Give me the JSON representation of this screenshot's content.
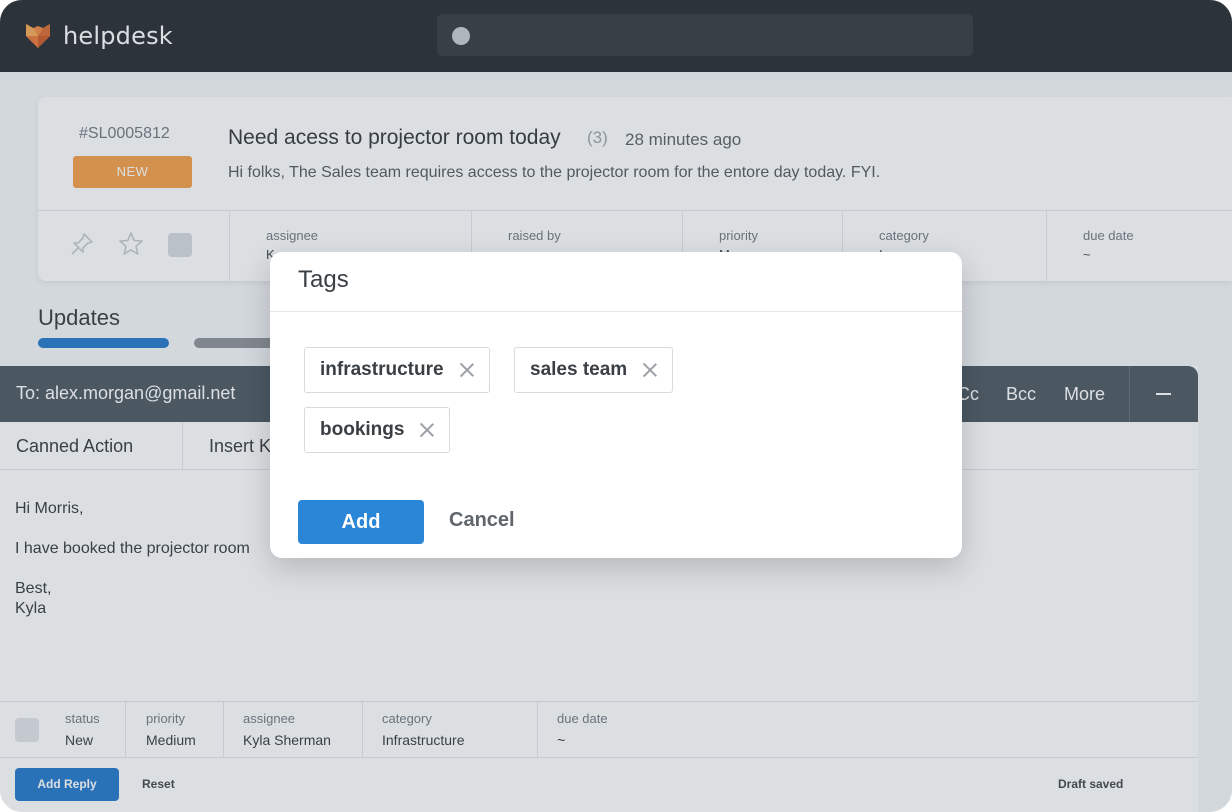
{
  "app": {
    "brand": "helpdesk",
    "logo_icon": "fox-logo-icon",
    "search_placeholder": ""
  },
  "ticket": {
    "id": "#SL0005812",
    "status_badge": "NEW",
    "title": "Need acess to projector room today",
    "reply_count": "(3)",
    "time_ago": "28 minutes ago",
    "description": "Hi folks, The Sales team requires access to the projector room for the entore day today. FYI.",
    "icons": [
      "pin-icon",
      "star-icon",
      "checkbox-icon"
    ],
    "meta": [
      {
        "label": "assignee",
        "value": "K"
      },
      {
        "label": "raised by",
        "value": ""
      },
      {
        "label": "priority",
        "value": "M"
      },
      {
        "label": "category",
        "value": "I          re"
      },
      {
        "label": "due date",
        "value": "~"
      }
    ]
  },
  "updates": {
    "title": "Updates"
  },
  "composer": {
    "to": "To: alex.morgan@gmail.net",
    "cc": "Cc",
    "bcc": "Bcc",
    "more": "More",
    "toolbar": {
      "canned": "Canned Action",
      "insert": "Insert K"
    },
    "body": {
      "line1": "Hi  Morris,",
      "line2": "I have booked the projector room",
      "line3": "Best,",
      "line4": "Kyla"
    },
    "footer": [
      {
        "label": "status",
        "value": "New"
      },
      {
        "label": "priority",
        "value": "Medium"
      },
      {
        "label": "assignee",
        "value": "Kyla Sherman"
      },
      {
        "label": "category",
        "value": "Infrastructure"
      },
      {
        "label": "due date",
        "value": "~"
      }
    ],
    "add_reply": "Add Reply",
    "reset": "Reset",
    "draft_status": "Draft saved"
  },
  "modal": {
    "title": "Tags",
    "tags": [
      "infrastructure",
      "sales team",
      "bookings"
    ],
    "add_label": "Add",
    "cancel_label": "Cancel"
  },
  "colors": {
    "topbar": "#1e2328",
    "accent": "#2a86d6",
    "badge_new": "#f59c42",
    "composer_header": "#46525c"
  }
}
